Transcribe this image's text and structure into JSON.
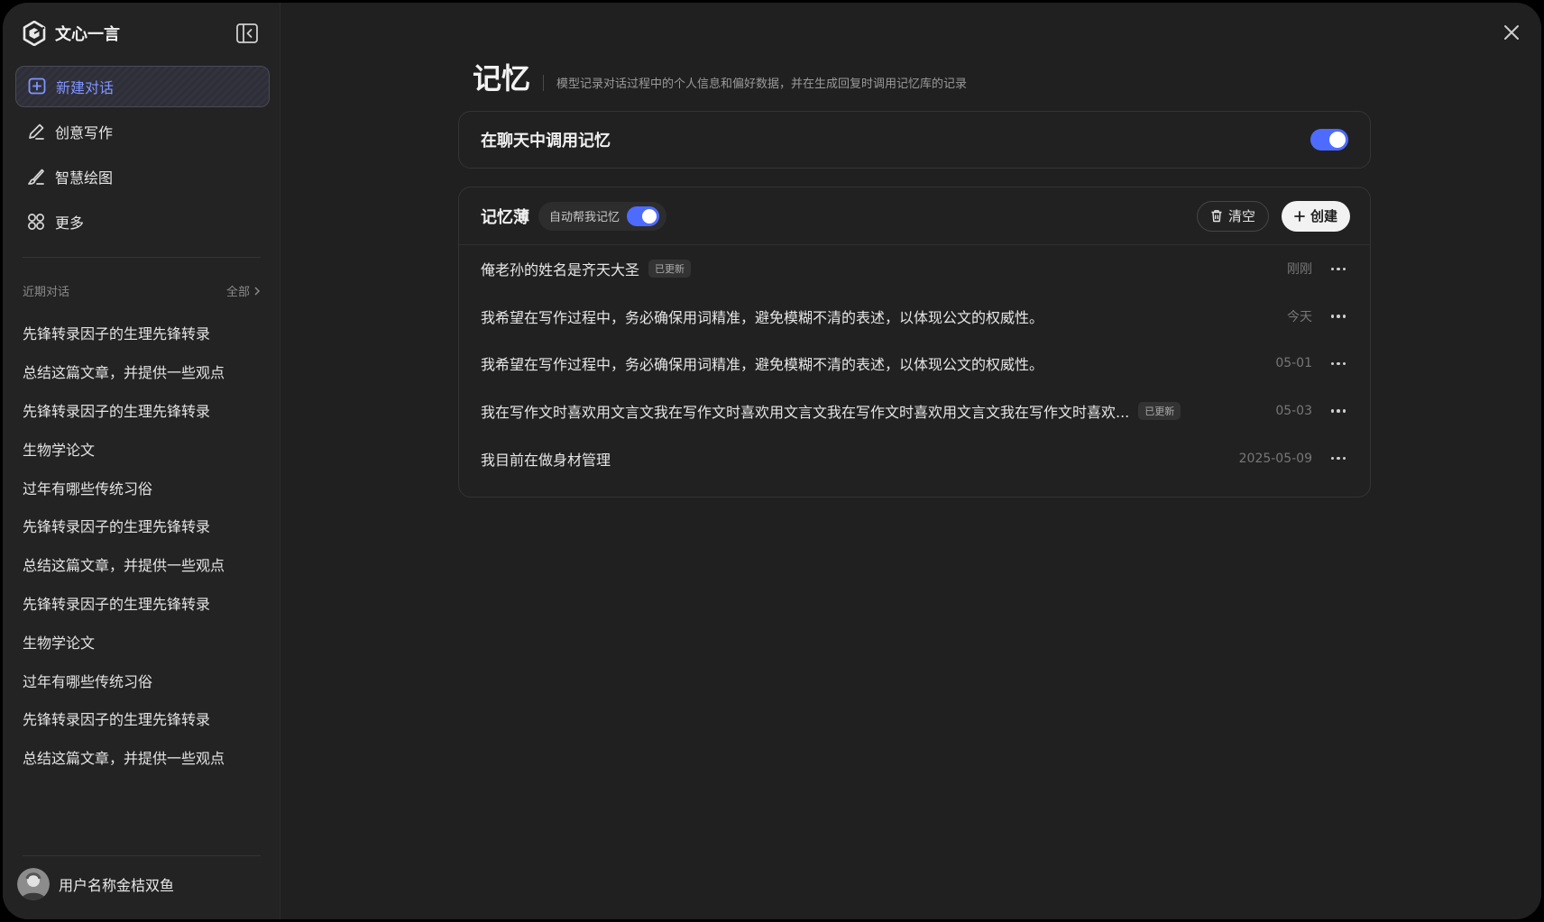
{
  "app": {
    "name": "文心一言"
  },
  "sidebar": {
    "nav": [
      {
        "label": "新建对话",
        "icon": "new-chat-icon",
        "active": true
      },
      {
        "label": "创意写作",
        "icon": "pen-icon"
      },
      {
        "label": "智慧绘图",
        "icon": "brush-icon"
      },
      {
        "label": "更多",
        "icon": "grid-icon"
      }
    ],
    "recent_title": "近期对话",
    "recent_all": "全部",
    "recent": [
      "先锋转录因子的生理先锋转录",
      "总结这篇文章，并提供一些观点",
      "先锋转录因子的生理先锋转录",
      "生物学论文",
      "过年有哪些传统习俗",
      "先锋转录因子的生理先锋转录",
      "总结这篇文章，并提供一些观点",
      "先锋转录因子的生理先锋转录",
      "生物学论文",
      "过年有哪些传统习俗",
      "先锋转录因子的生理先锋转录",
      "总结这篇文章，并提供一些观点"
    ],
    "user_name": "用户名称金桔双鱼"
  },
  "main": {
    "title": "记忆",
    "subtitle": "模型记录对话过程中的个人信息和偏好数据，并在生成回复时调用记忆库的记录",
    "use_memory": {
      "label": "在聊天中调用记忆",
      "enabled": true
    },
    "notebook": {
      "title": "记忆薄",
      "auto_label": "自动帮我记忆",
      "auto_enabled": true,
      "clear_label": "清空",
      "create_label": "创建",
      "items": [
        {
          "text": "俺老孙的姓名是齐天大圣",
          "badge": "已更新",
          "time": "刚刚"
        },
        {
          "text": "我希望在写作过程中，务必确保用词精准，避免模糊不清的表述，以体现公文的权威性。",
          "badge": "",
          "time": "今天"
        },
        {
          "text": "我希望在写作过程中，务必确保用词精准，避免模糊不清的表述，以体现公文的权威性。",
          "badge": "",
          "time": "05-01"
        },
        {
          "text": "我在写作文时喜欢用文言文我在写作文时喜欢用文言文我在写作文时喜欢用文言文我在写作文时喜欢...",
          "badge": "已更新",
          "time": "05-03"
        },
        {
          "text": "我目前在做身材管理",
          "badge": "",
          "time": "2025-05-09"
        }
      ]
    }
  },
  "colors": {
    "accent": "#4e6bff",
    "background": "#202020",
    "sidebar": "#232323"
  }
}
